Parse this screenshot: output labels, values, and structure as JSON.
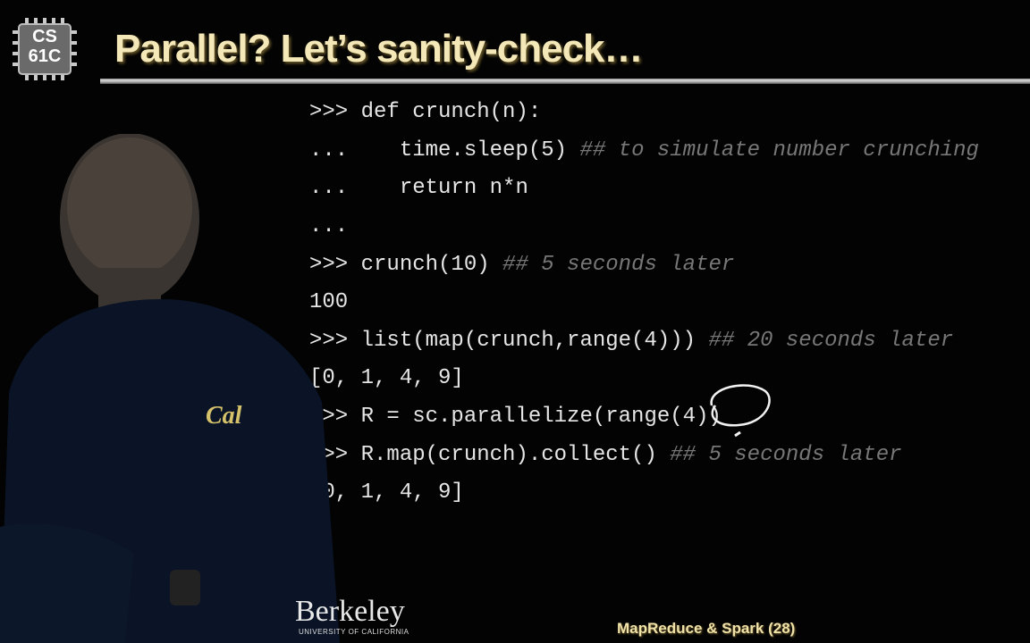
{
  "logo": {
    "line1": "CS",
    "line2": "61C"
  },
  "title": "Parallel? Let’s sanity-check…",
  "code": [
    {
      "text": ">>> def crunch(n):",
      "comment": ""
    },
    {
      "text": "...    time.sleep(5) ",
      "comment": "## to simulate number crunching"
    },
    {
      "text": "...    return n*n",
      "comment": ""
    },
    {
      "text": "...",
      "comment": ""
    },
    {
      "text": ">>> crunch(10) ",
      "comment": "## 5 seconds later"
    },
    {
      "text": "100",
      "comment": ""
    },
    {
      "text": ">>> list(map(crunch,range(4))) ",
      "comment": "## 20 seconds later"
    },
    {
      "text": "[0, 1, 4, 9]",
      "comment": ""
    },
    {
      "text": ">>> R = sc.parallelize(range(4))",
      "comment": ""
    },
    {
      "text": ">>> R.map(crunch).collect() ",
      "comment": "## 5 seconds later"
    },
    {
      "text": "[0, 1, 4, 9]",
      "comment": ""
    }
  ],
  "shirt_logo": "Cal",
  "footer": {
    "logo": "Berkeley",
    "logo_sub": "UNIVERSITY OF CALIFORNIA",
    "page": "MapReduce & Spark (28)"
  }
}
